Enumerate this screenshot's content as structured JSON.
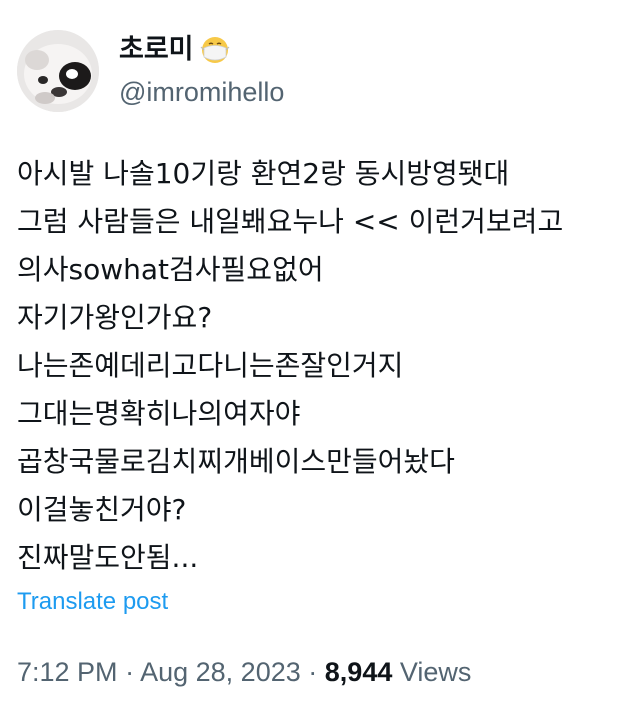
{
  "author": {
    "display_name": "초로미",
    "handle": "@imromihello",
    "badge_icon": "masked-face-icon"
  },
  "tweet": {
    "lines": [
      "아시발 나솔10기랑 환연2랑 동시방영됏대",
      "그럼 사람들은 내일봬요누나 << 이런거보려고",
      "의사sowhat검사필요없어",
      "자기가왕인가요?",
      "나는존예데리고다니는존잘인거지",
      "그대는명확히나의여자야",
      "곱창국물로김치찌개베이스만들어놨다",
      "이걸놓친거야?",
      "진짜말도안됨..."
    ]
  },
  "translate_label": "Translate post",
  "meta": {
    "time": "7:12 PM",
    "separator": "·",
    "date": "Aug 28, 2023",
    "views_count": "8,944",
    "views_label": "Views"
  },
  "colors": {
    "text": "#0f1419",
    "secondary": "#536471",
    "link": "#1d9bf0"
  }
}
